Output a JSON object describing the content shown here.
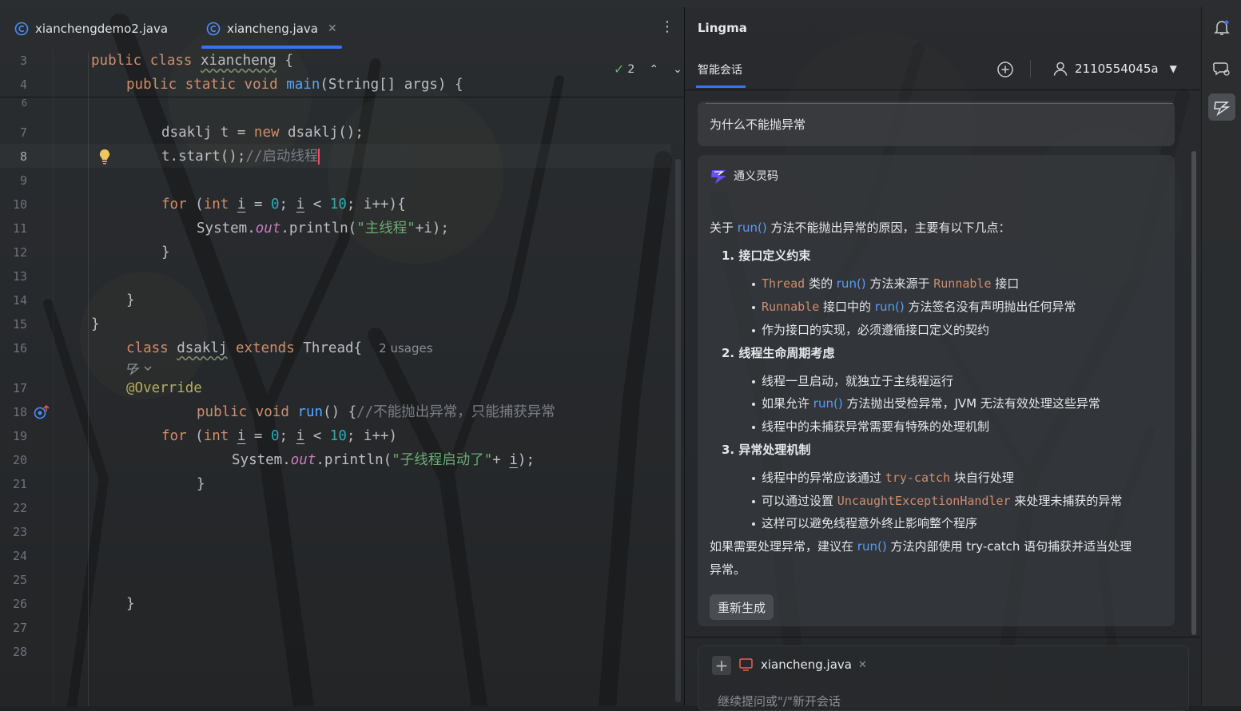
{
  "editor": {
    "tabs": [
      {
        "label": "xianchengdemo2.java",
        "active": false
      },
      {
        "label": "xiancheng.java",
        "active": true
      }
    ],
    "inspection_count": "2",
    "lines": [
      {
        "num": "3"
      },
      {
        "num": "4"
      },
      {
        "num": "6"
      },
      {
        "num": "7"
      },
      {
        "num": "8"
      },
      {
        "num": "9"
      },
      {
        "num": "10"
      },
      {
        "num": "11"
      },
      {
        "num": "12"
      },
      {
        "num": "13"
      },
      {
        "num": "14"
      },
      {
        "num": "15"
      },
      {
        "num": "16"
      },
      {
        "num": "17"
      },
      {
        "num": "18"
      },
      {
        "num": "19"
      },
      {
        "num": "20"
      },
      {
        "num": "21"
      },
      {
        "num": "22"
      },
      {
        "num": "23"
      },
      {
        "num": "24"
      },
      {
        "num": "25"
      },
      {
        "num": "26"
      },
      {
        "num": "27"
      },
      {
        "num": "28"
      }
    ],
    "code": {
      "public": "public",
      "class": "class",
      "static": "static",
      "void": "void",
      "new": "new",
      "for": "for",
      "int": "int",
      "extends": "extends",
      "xiancheng": "xiancheng",
      "main": "main",
      "main_params": "(String[] args) {",
      "brace_open": " {",
      "l7_a": "dsaklj t = ",
      "l7_b": " dsaklj();",
      "l8_a": "t.start();",
      "l8_comment": "//启动线程",
      "l10_a": " (",
      "i": "i",
      "eq": " = ",
      "zero": "0",
      "semi": "; ",
      "lt": " < ",
      "ten": "10",
      "l10_end": "; i++){",
      "l11_a": "System.",
      "out": "out",
      "l11_b": ".println(",
      "l11_str": "\"主线程\"",
      "l11_c": "+i);",
      "brace_close": "}",
      "dsaklj": "dsaklj",
      "thread_brace": " Thread{",
      "usages": "2 usages",
      "override": "@Override",
      "run": "run",
      "run_parens": "() {",
      "run_comment": "//不能抛出异常，只能捕获异常",
      "l19_end": "; i++)",
      "l20_str": "\"子线程启动了\"",
      "l20_c": "+ ",
      "l20_d": ");"
    }
  },
  "panel": {
    "title": "Lingma",
    "tab": "智能会话",
    "user": "2110554045a",
    "question": "为什么不能抛异常",
    "assistant_name": "通义灵码",
    "intro_a": "关于",
    "intro_run": "run()",
    "intro_b": "方法不能抛出异常的原因，主要有以下几点：",
    "s1_title": "1. 接口定义约束",
    "s1_b1_thread": "Thread",
    "s1_b1_a": "类的",
    "s1_b1_run": "run()",
    "s1_b1_b": "方法来源于",
    "s1_b1_runnable": "Runnable",
    "s1_b1_c": "接口",
    "s1_b2_runnable": "Runnable",
    "s1_b2_a": "接口中的",
    "s1_b2_run": "run()",
    "s1_b2_b": "方法签名没有声明抛出任何异常",
    "s1_b3": "作为接口的实现，必须遵循接口定义的契约",
    "s2_title": "2. 线程生命周期考虑",
    "s2_b1": "线程一旦启动，就独立于主线程运行",
    "s2_b2_a": "如果允许",
    "s2_b2_run": "run()",
    "s2_b2_b": "方法抛出受检异常，JVM 无法有效处理这些异常",
    "s2_b3": "线程中的未捕获异常需要有特殊的处理机制",
    "s3_title": "3. 异常处理机制",
    "s3_b1_a": "线程中的异常应该通过",
    "s3_b1_code": "try-catch",
    "s3_b1_b": "块自行处理",
    "s3_b2_a": "可以通过设置",
    "s3_b2_code": "UncaughtExceptionHandler",
    "s3_b2_b": "来处理未捕获的异常",
    "s3_b3": "这样可以避免线程意外终止影响整个程序",
    "outro_a": "如果需要处理异常，建议在",
    "outro_run": "run()",
    "outro_b": "方法内部使用 try-catch 语句捕获并适当处理",
    "outro_c": "异常。",
    "regen": "重新生成",
    "attached_file": "xiancheng.java",
    "input_placeholder": "继续提问或\"/\"新开会话"
  },
  "icons": {
    "file": "java-class-icon",
    "bulb": "lightbulb-icon",
    "override": "override-method-icon",
    "plus": "new-chat-icon",
    "user": "user-icon",
    "assistant": "tongyi-lingma-icon",
    "bell": "notifications-icon",
    "ai": "ai-assistant-icon"
  },
  "colors": {
    "accent": "#3574f0",
    "keyword": "#cf8e6d",
    "function": "#56a8f5",
    "number": "#2aacb8",
    "string": "#6aab73",
    "comment": "#7a7e85"
  }
}
